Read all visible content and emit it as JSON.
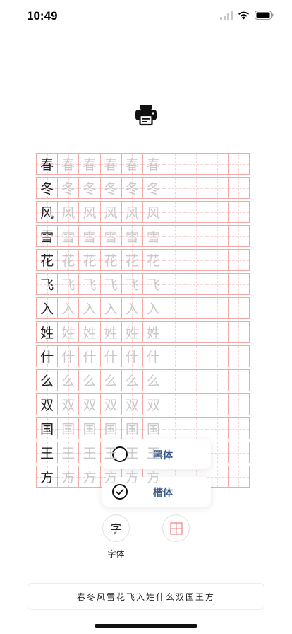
{
  "status_bar": {
    "time": "10:49"
  },
  "icons": {
    "printer": "printer-icon",
    "grid": "grid-icon",
    "wifi": "wifi-icon",
    "battery": "battery-icon",
    "signal": "cellular-signal-icon"
  },
  "colors": {
    "grid_line": "#f4a9a9",
    "grid_dash": "#f8d2d2",
    "trace_text": "#c9c9c9",
    "menu_label": "#3a5a8c",
    "accent_red": "#f07c7c"
  },
  "grid": {
    "characters": [
      "春",
      "冬",
      "风",
      "雪",
      "花",
      "飞",
      "入",
      "姓",
      "什",
      "么",
      "双",
      "国",
      "王",
      "方"
    ],
    "columns": 10,
    "trace_count": 5
  },
  "font_menu": {
    "items": [
      {
        "label": "黑体",
        "selected": false
      },
      {
        "label": "楷体",
        "selected": true
      }
    ]
  },
  "controls": {
    "font_button": "字",
    "font_button_label": "字体"
  },
  "input": {
    "value": "春冬风雪花飞入姓什么双国王方"
  }
}
